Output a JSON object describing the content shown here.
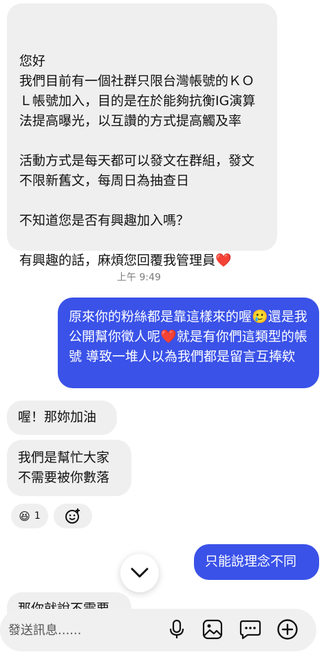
{
  "messages": {
    "incoming_1": {
      "lines": [
        "您好",
        "我們目前有一個社群只限台灣帳號的ＫＯＬ帳號加入，目的是在於能夠抗衡IG演算法提高曝光，以互讚的方式提高觸及率",
        "",
        "活動方式是每天都可以發文在群組，發文不限新舊文，每周日為抽查日",
        "",
        "不知道您是否有興趣加入嗎？",
        "",
        "有興趣的話，麻煩您回覆我管理員"
      ],
      "heart": "❤️"
    },
    "timestamp": "上午 9:49",
    "outgoing_1": {
      "part_1": "原來你的粉絲都是靠這樣來的喔",
      "emoji_1": "🥲",
      "part_2": "還是我公開幫你徵人呢",
      "emoji_2": "❤️",
      "part_3": "就是有你們這類型的帳號 導致一堆人以為我們都是留言互捧欸"
    },
    "incoming_2": "喔！那妳加油",
    "incoming_3_line_1": "我們是幫忙大家",
    "incoming_3_line_2": "不需要被你數落",
    "reaction": {
      "emoji": "😆",
      "count": "1"
    },
    "outgoing_2": "只能說理念不同",
    "incoming_partial": "那你就說不需要"
  },
  "composer": {
    "placeholder": "發送訊息......",
    "icons": [
      "microphone-icon",
      "image-icon",
      "sticker-icon",
      "add-icon"
    ]
  },
  "colors": {
    "outgoing_bubble": "#3a52e8",
    "incoming_bubble": "#efefef",
    "heart": "#e0202e"
  }
}
